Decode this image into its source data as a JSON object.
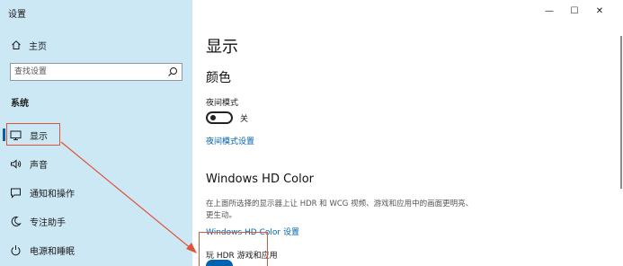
{
  "window": {
    "title": "设置",
    "controls": {
      "minimize": "—",
      "maximize": "☐",
      "close": "✕"
    }
  },
  "sidebar": {
    "home_label": "主页",
    "search_placeholder": "查找设置",
    "section_label": "系统",
    "items": [
      {
        "label": "显示",
        "icon": "monitor-icon",
        "active": true
      },
      {
        "label": "声音",
        "icon": "speaker-icon",
        "active": false
      },
      {
        "label": "通知和操作",
        "icon": "notification-icon",
        "active": false
      },
      {
        "label": "专注助手",
        "icon": "moon-icon",
        "active": false
      },
      {
        "label": "电源和睡眠",
        "icon": "power-icon",
        "active": false
      }
    ]
  },
  "main": {
    "title": "显示",
    "color_heading": "颜色",
    "night_mode_label": "夜间模式",
    "night_mode_state": "关",
    "night_mode_link": "夜间模式设置",
    "hdr_heading": "Windows HD Color",
    "hdr_description": "在上面所选择的显示器上让 HDR 和 WCG 视频、游戏和应用中的画面更明亮、更生动。",
    "hdr_link": "Windows HD Color 设置",
    "hdr_games_label": "玩 HDR 游戏和应用"
  },
  "colors": {
    "sidebar_bg": "#cce8f4",
    "accent": "#0063b1",
    "annotation": "#e0533c"
  }
}
